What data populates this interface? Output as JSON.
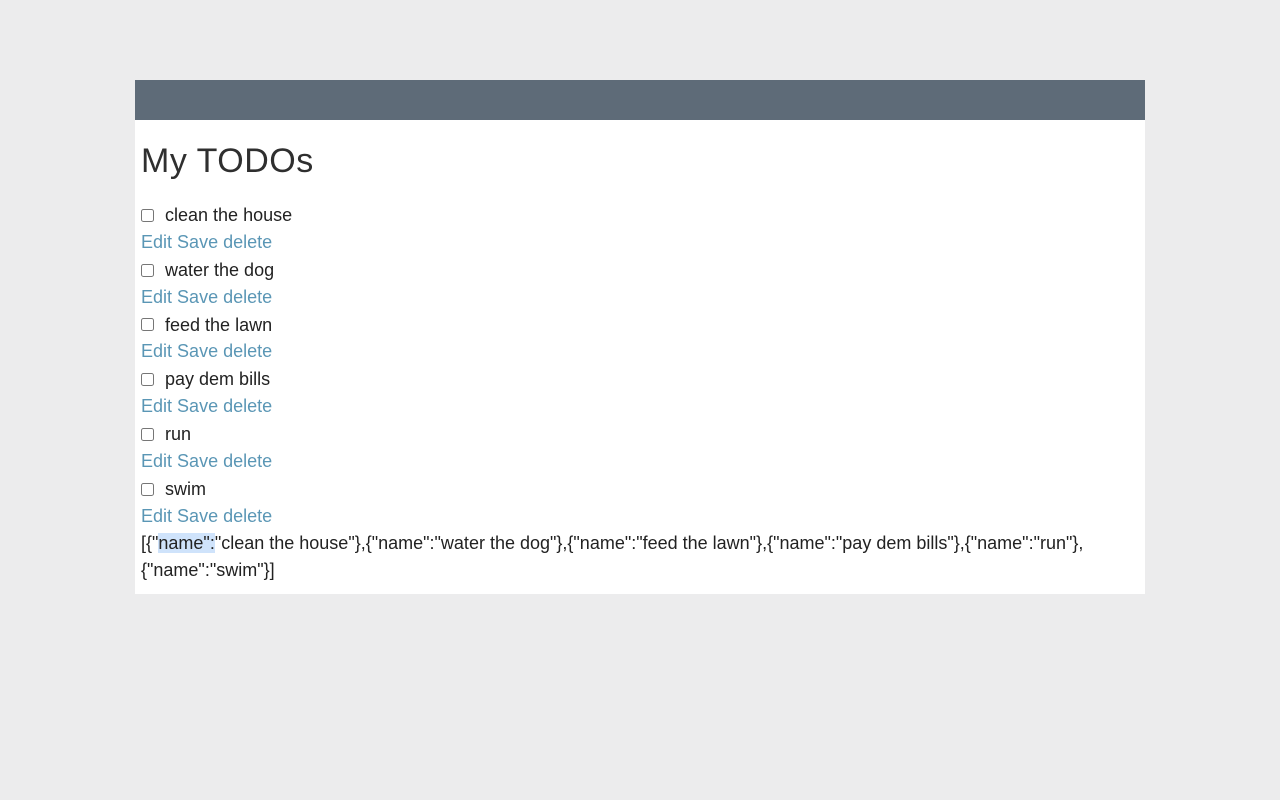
{
  "page": {
    "title": "My TODOs"
  },
  "actions": {
    "edit": "Edit",
    "save": "Save",
    "delete": "delete"
  },
  "todos": [
    {
      "label": "clean the house",
      "checked": false
    },
    {
      "label": "water the dog",
      "checked": false
    },
    {
      "label": "feed the lawn",
      "checked": false
    },
    {
      "label": "pay dem bills",
      "checked": false
    },
    {
      "label": "run",
      "checked": false
    },
    {
      "label": "swim",
      "checked": false
    }
  ],
  "json_dump": {
    "prefix": "[{\"",
    "highlight": "name\":",
    "rest": "\"clean the house\"},{\"name\":\"water the dog\"},{\"name\":\"feed the lawn\"},{\"name\":\"pay dem bills\"},{\"name\":\"run\"},{\"name\":\"swim\"}]"
  }
}
